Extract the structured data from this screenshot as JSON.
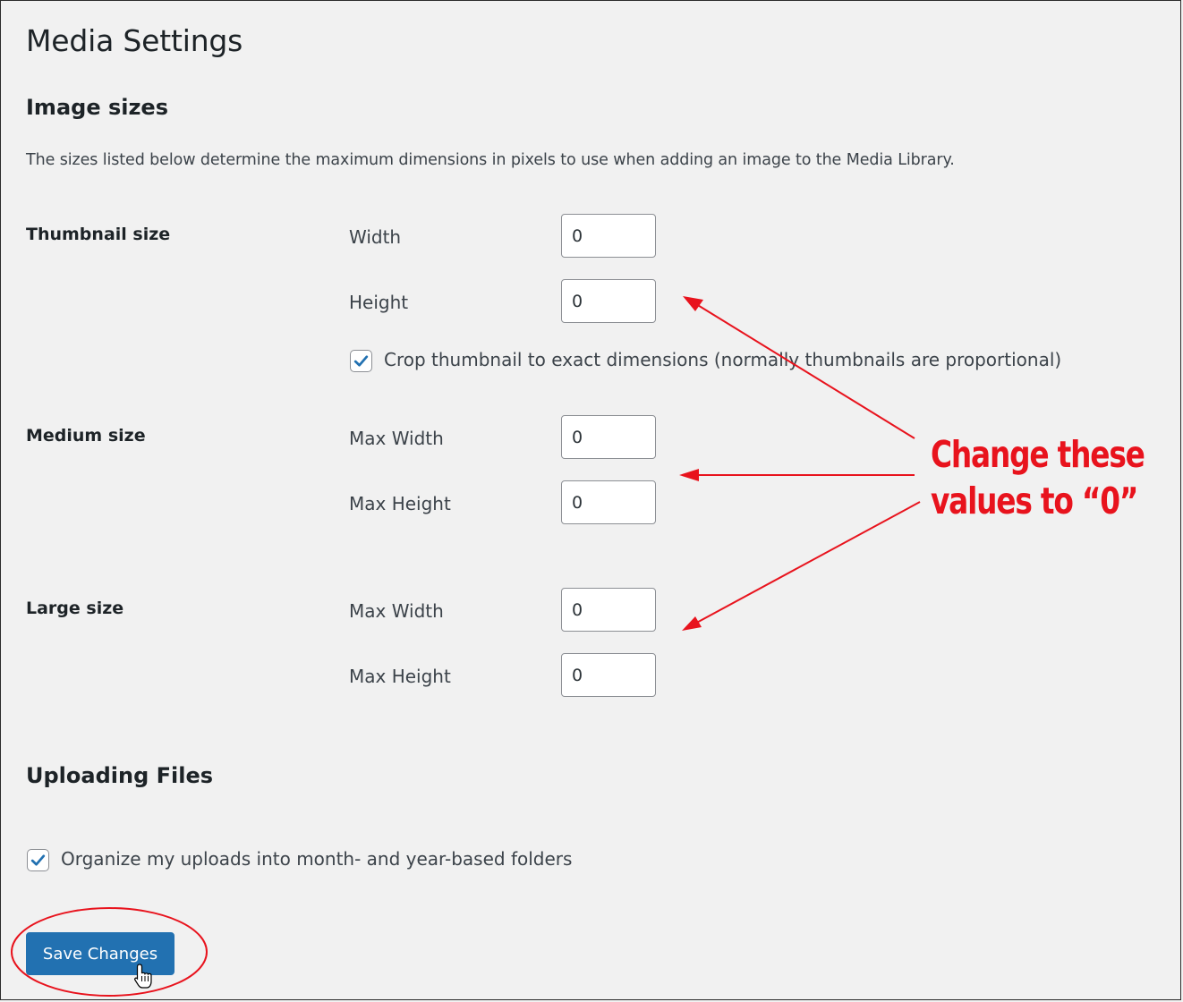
{
  "page": {
    "title": "Media Settings"
  },
  "image_sizes": {
    "heading": "Image sizes",
    "description": "The sizes listed below determine the maximum dimensions in pixels to use when adding an image to the Media Library.",
    "thumbnail": {
      "label": "Thumbnail size",
      "width_label": "Width",
      "width_value": "0",
      "height_label": "Height",
      "height_value": "0",
      "crop_checked": true,
      "crop_label": "Crop thumbnail to exact dimensions (normally thumbnails are proportional)"
    },
    "medium": {
      "label": "Medium size",
      "max_width_label": "Max Width",
      "max_width_value": "0",
      "max_height_label": "Max Height",
      "max_height_value": "0"
    },
    "large": {
      "label": "Large size",
      "max_width_label": "Max Width",
      "max_width_value": "0",
      "max_height_label": "Max Height",
      "max_height_value": "0"
    }
  },
  "uploading": {
    "heading": "Uploading Files",
    "organize_checked": true,
    "organize_label": "Organize my uploads into month- and year-based folders"
  },
  "actions": {
    "save_label": "Save Changes"
  },
  "annotation": {
    "line1": "Change these",
    "line2": "values to “0”",
    "color": "#e8131d"
  },
  "colors": {
    "background": "#f1f1f1",
    "primary_button": "#2271b1",
    "checkbox_check": "#2271b1"
  }
}
